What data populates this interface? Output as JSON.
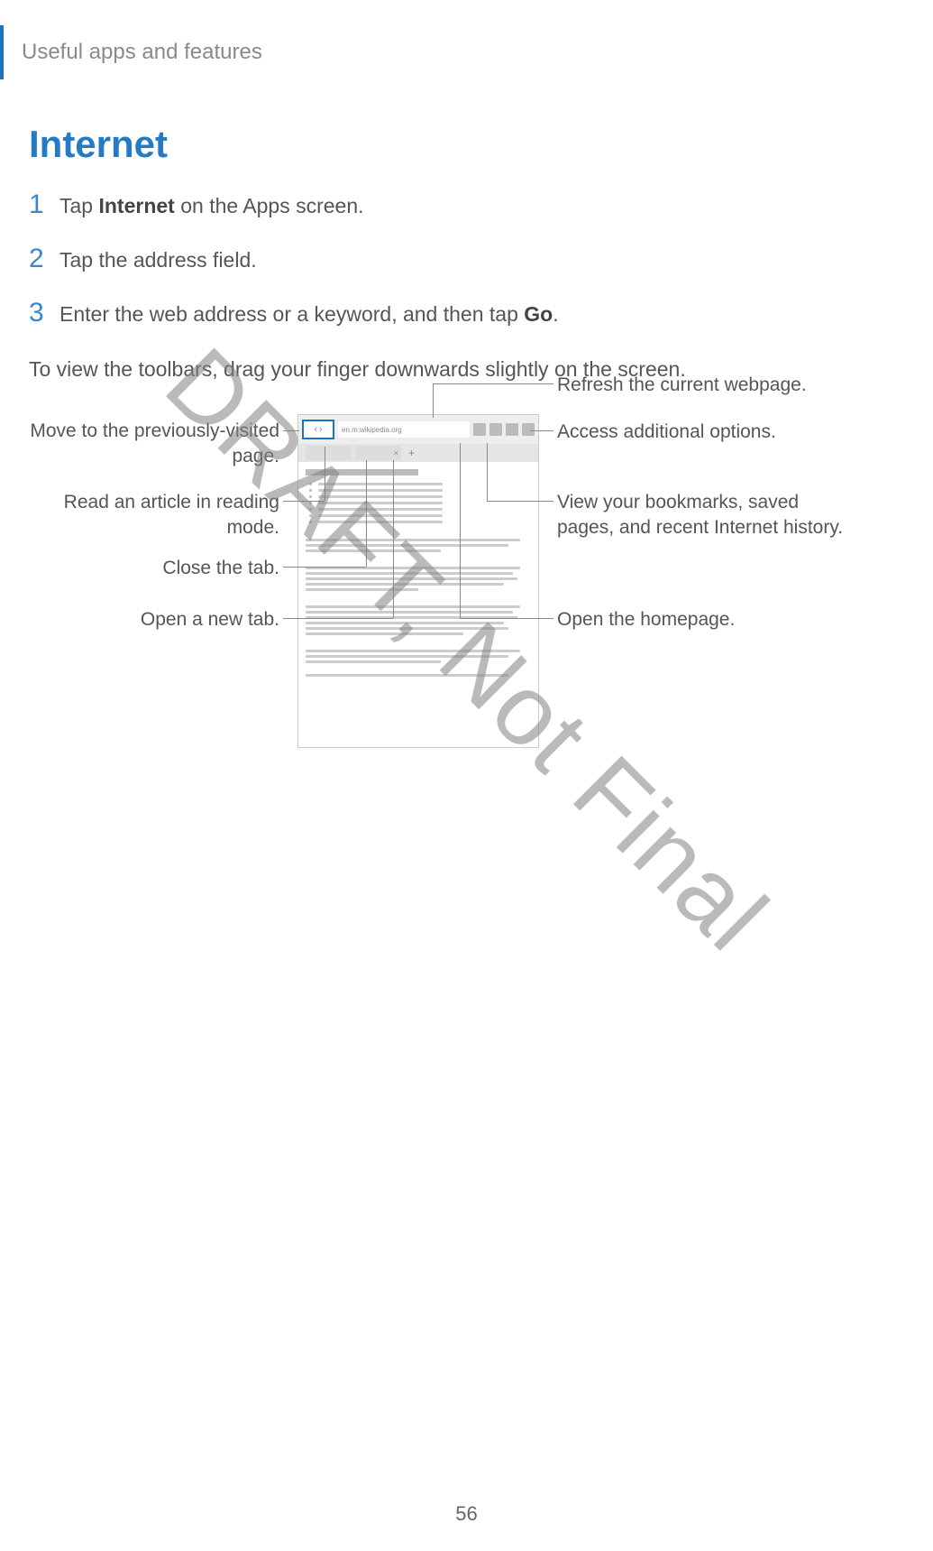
{
  "header": {
    "section": "Useful apps and features"
  },
  "title": "Internet",
  "steps": {
    "s1_a": "Tap ",
    "s1_b": "Internet",
    "s1_c": " on the Apps screen.",
    "s2": "Tap the address field.",
    "s3_a": "Enter the web address or a keyword, and then tap ",
    "s3_b": "Go",
    "s3_c": "."
  },
  "paragraph": "To view the toolbars, drag your finger downwards slightly on the screen.",
  "callouts": {
    "left": {
      "nav": "Move to the previously-visited page.",
      "reader": "Read an article in reading mode.",
      "close": "Close the tab.",
      "newtab": "Open a new tab."
    },
    "right": {
      "refresh": "Refresh the current webpage.",
      "options": "Access additional options.",
      "bookmarks": "View your bookmarks, saved pages, and recent Internet history.",
      "home": "Open the homepage."
    }
  },
  "screenshot": {
    "url_text": "en.m.wikipedia.org",
    "tab_close": "×",
    "plus": "+",
    "nav_back": "‹",
    "nav_fwd": "›"
  },
  "watermark": "DRAFT, Not Final",
  "page_number": "56"
}
